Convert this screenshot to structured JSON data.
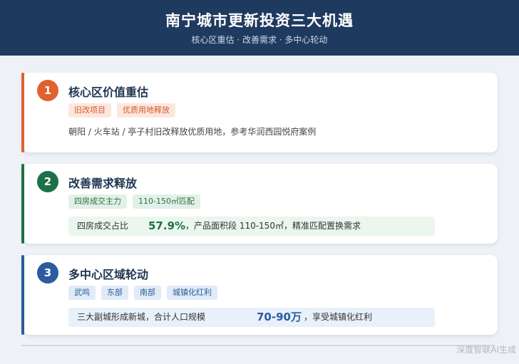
{
  "header": {
    "title": "南宁城市更新投资三大机遇",
    "subtitle": "核心区重估 · 改善需求 · 多中心轮动"
  },
  "cards": [
    {
      "num": "1",
      "title": "核心区价值重估",
      "tags": [
        "旧改项目",
        "优质用地释放"
      ],
      "desc": "朝阳 / 火车站 / 亭子村旧改释放优质用地，参考华润西园悦府案例"
    },
    {
      "num": "2",
      "title": "改善需求释放",
      "tags": [
        "四房成交主力",
        "110-150㎡匹配"
      ],
      "highlight": {
        "prefix": "四房成交占比",
        "value": "57.9%",
        "suffix": "，产品面积段 110-150㎡，精准匹配置换需求"
      }
    },
    {
      "num": "3",
      "title": "多中心区域轮动",
      "tags": [
        "武鸣",
        "东部",
        "南部",
        "城镇化红利"
      ],
      "highlight": {
        "prefix": "三大副城形成新城，合计人口规模",
        "value": "70-90万",
        "suffix": "，享受城镇化红利"
      }
    }
  ],
  "watermark": "深度智联AI生成",
  "colors": {
    "header_bg": "#1f3a5f",
    "accent_orange": "#e0622e",
    "accent_green": "#1e7048",
    "accent_blue": "#2a5c9e"
  }
}
